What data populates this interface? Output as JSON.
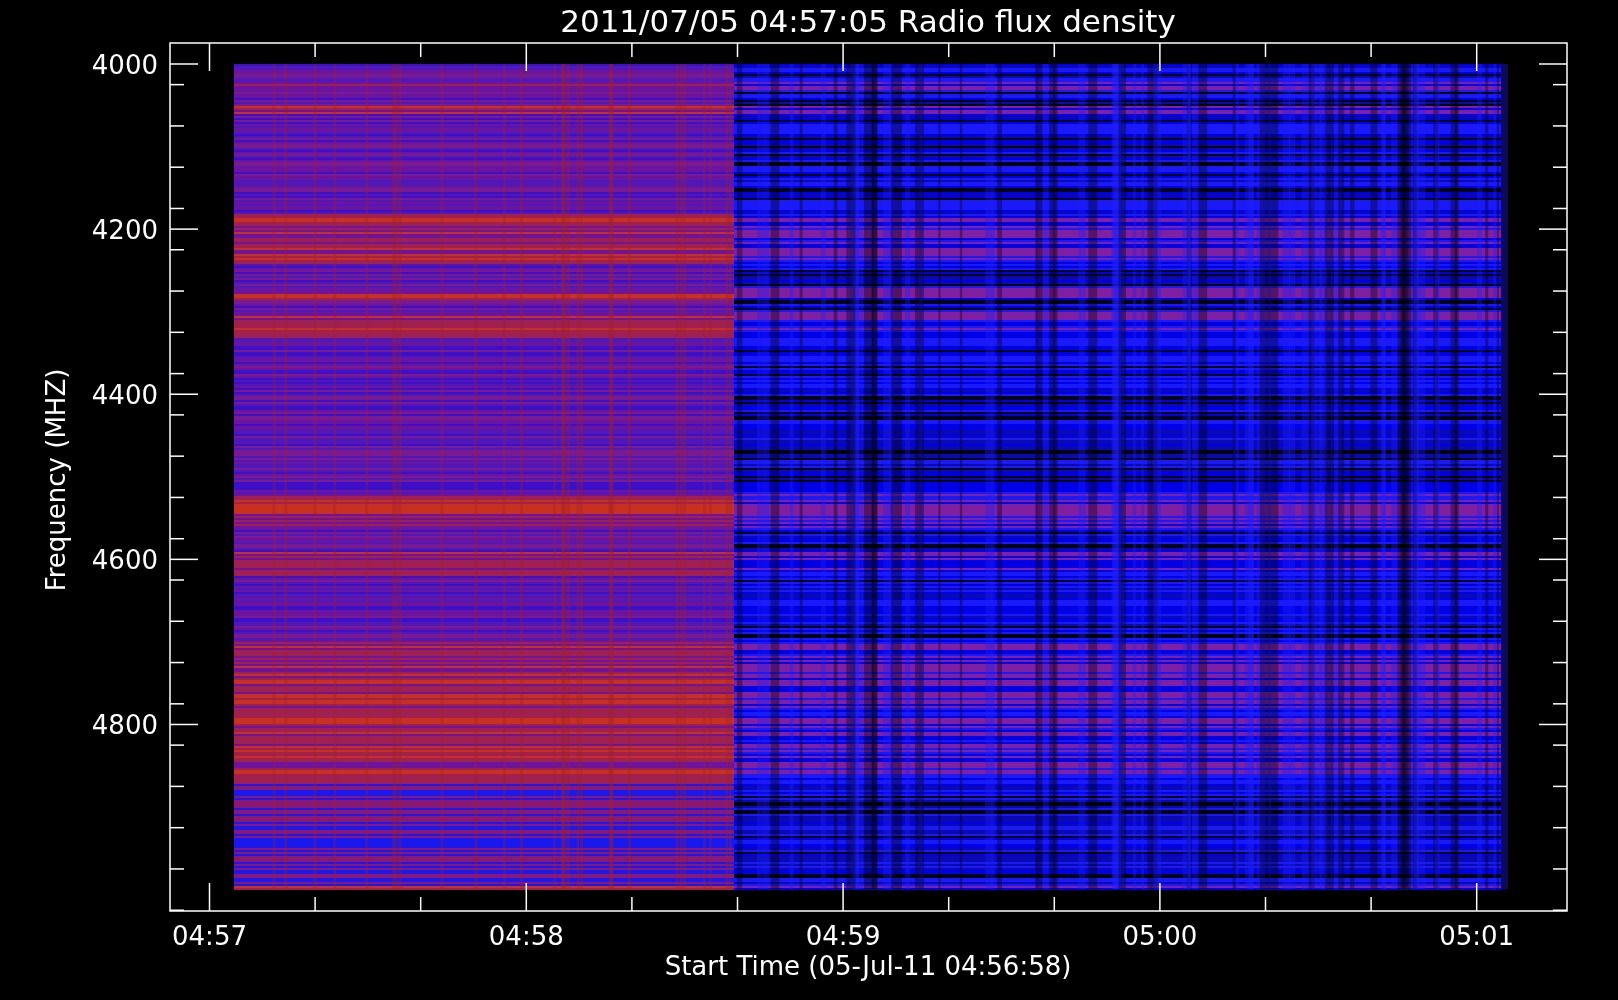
{
  "title": "2011/07/05 04:57:05 Radio flux density",
  "plot": {
    "ylabel": "Frequency (MHZ)",
    "xlabel": "Start Time (05-Jul-11 04:56:58)",
    "ytick_labels": [
      "4000",
      "4200",
      "4400",
      "4600",
      "4800"
    ],
    "xtick_labels": [
      "04:57",
      "04:58",
      "04:59",
      "05:00",
      "05:01"
    ]
  }
}
